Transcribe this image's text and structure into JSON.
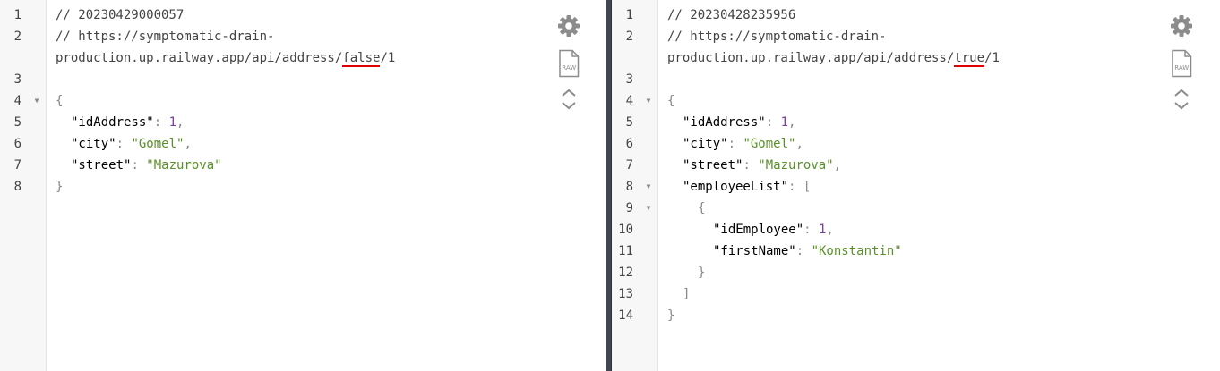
{
  "left_pane": {
    "lines": [
      {
        "num": "1",
        "parts": [
          {
            "t": "// 20230429000057",
            "c": "c-comment"
          }
        ]
      },
      {
        "num": "2",
        "parts": [
          {
            "t": "// https://symptomatic-drain-",
            "c": "c-comment"
          }
        ]
      },
      {
        "num": "",
        "parts": [
          {
            "t": "production.up.railway.app/api/address/",
            "c": "c-comment"
          },
          {
            "t": "false",
            "c": "c-comment underline-red"
          },
          {
            "t": "/1",
            "c": "c-comment"
          }
        ]
      },
      {
        "num": "3",
        "parts": []
      },
      {
        "num": "4",
        "fold": true,
        "parts": [
          {
            "t": "{",
            "c": "c-brace"
          }
        ]
      },
      {
        "num": "5",
        "indent": 1,
        "parts": [
          {
            "t": "\"idAddress\"",
            "c": "c-key"
          },
          {
            "t": ": ",
            "c": "c-punct"
          },
          {
            "t": "1",
            "c": "c-num"
          },
          {
            "t": ",",
            "c": "c-punct"
          }
        ]
      },
      {
        "num": "6",
        "indent": 1,
        "parts": [
          {
            "t": "\"city\"",
            "c": "c-key"
          },
          {
            "t": ": ",
            "c": "c-punct"
          },
          {
            "t": "\"Gomel\"",
            "c": "c-str"
          },
          {
            "t": ",",
            "c": "c-punct"
          }
        ]
      },
      {
        "num": "7",
        "indent": 1,
        "parts": [
          {
            "t": "\"street\"",
            "c": "c-key"
          },
          {
            "t": ": ",
            "c": "c-punct"
          },
          {
            "t": "\"Mazurova\"",
            "c": "c-str"
          }
        ]
      },
      {
        "num": "8",
        "parts": [
          {
            "t": "}",
            "c": "c-brace"
          }
        ]
      }
    ]
  },
  "right_pane": {
    "lines": [
      {
        "num": "1",
        "parts": [
          {
            "t": "// 20230428235956",
            "c": "c-comment"
          }
        ]
      },
      {
        "num": "2",
        "parts": [
          {
            "t": "// https://symptomatic-drain-",
            "c": "c-comment"
          }
        ]
      },
      {
        "num": "",
        "parts": [
          {
            "t": "production.up.railway.app/api/address/",
            "c": "c-comment"
          },
          {
            "t": "true",
            "c": "c-comment underline-red"
          },
          {
            "t": "/1",
            "c": "c-comment"
          }
        ]
      },
      {
        "num": "3",
        "parts": []
      },
      {
        "num": "4",
        "fold": true,
        "parts": [
          {
            "t": "{",
            "c": "c-brace"
          }
        ]
      },
      {
        "num": "5",
        "indent": 1,
        "parts": [
          {
            "t": "\"idAddress\"",
            "c": "c-key"
          },
          {
            "t": ": ",
            "c": "c-punct"
          },
          {
            "t": "1",
            "c": "c-num"
          },
          {
            "t": ",",
            "c": "c-punct"
          }
        ]
      },
      {
        "num": "6",
        "indent": 1,
        "parts": [
          {
            "t": "\"city\"",
            "c": "c-key"
          },
          {
            "t": ": ",
            "c": "c-punct"
          },
          {
            "t": "\"Gomel\"",
            "c": "c-str"
          },
          {
            "t": ",",
            "c": "c-punct"
          }
        ]
      },
      {
        "num": "7",
        "indent": 1,
        "parts": [
          {
            "t": "\"street\"",
            "c": "c-key"
          },
          {
            "t": ": ",
            "c": "c-punct"
          },
          {
            "t": "\"Mazurova\"",
            "c": "c-str"
          },
          {
            "t": ",",
            "c": "c-punct"
          }
        ]
      },
      {
        "num": "8",
        "fold": true,
        "indent": 1,
        "parts": [
          {
            "t": "\"employeeList\"",
            "c": "c-key"
          },
          {
            "t": ": [",
            "c": "c-punct"
          }
        ]
      },
      {
        "num": "9",
        "fold": true,
        "indent": 2,
        "parts": [
          {
            "t": "{",
            "c": "c-brace"
          }
        ]
      },
      {
        "num": "10",
        "indent": 3,
        "parts": [
          {
            "t": "\"idEmployee\"",
            "c": "c-key"
          },
          {
            "t": ": ",
            "c": "c-punct"
          },
          {
            "t": "1",
            "c": "c-num"
          },
          {
            "t": ",",
            "c": "c-punct"
          }
        ]
      },
      {
        "num": "11",
        "indent": 3,
        "parts": [
          {
            "t": "\"firstName\"",
            "c": "c-key"
          },
          {
            "t": ": ",
            "c": "c-punct"
          },
          {
            "t": "\"Konstantin\"",
            "c": "c-str"
          }
        ]
      },
      {
        "num": "12",
        "indent": 2,
        "parts": [
          {
            "t": "}",
            "c": "c-brace"
          }
        ]
      },
      {
        "num": "13",
        "indent": 1,
        "parts": [
          {
            "t": "]",
            "c": "c-brace"
          }
        ]
      },
      {
        "num": "14",
        "parts": [
          {
            "t": "}",
            "c": "c-brace"
          }
        ]
      }
    ]
  },
  "toolbar": {
    "settings_icon": "gear-icon",
    "raw_icon": "raw-file-icon",
    "raw_label": "RAW",
    "collapse_icon": "chevron-up-icon",
    "expand_icon": "chevron-down-icon",
    "icon_color": "#8c8c8c"
  },
  "colors": {
    "string": "#5a8f2a",
    "number": "#7a3e9d",
    "highlight_underline": "#e00000",
    "divider": "#3f4650"
  }
}
